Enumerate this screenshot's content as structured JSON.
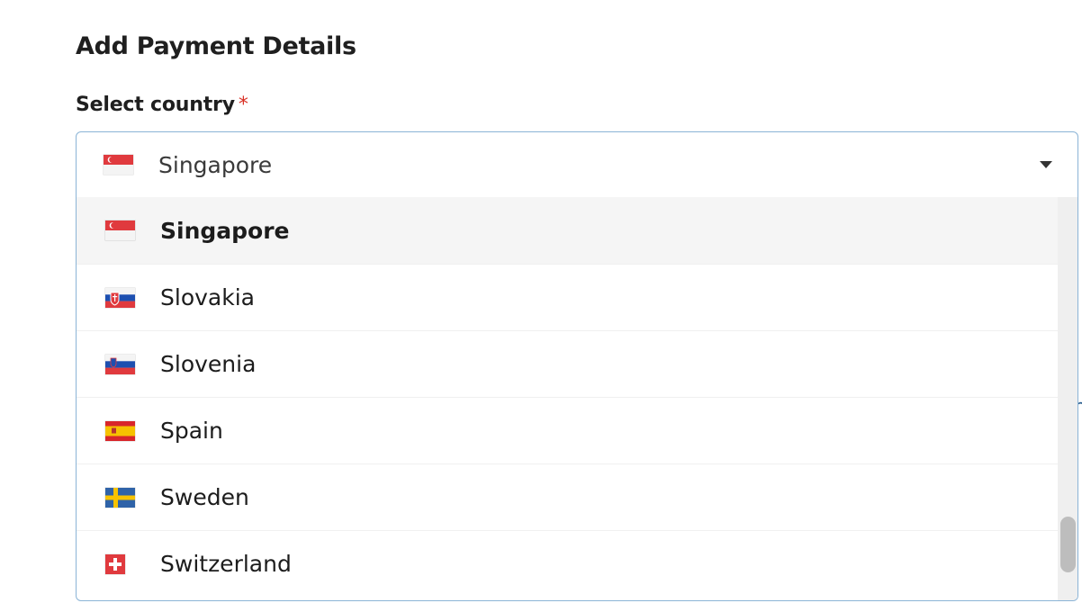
{
  "page": {
    "heading": "Add Payment Details",
    "country_label": "Select country",
    "required_mark": "*"
  },
  "select": {
    "selected_value": "Singapore",
    "selected_flag": "flag-singapore-icon",
    "options": [
      {
        "label": "Singapore",
        "flag": "flag-singapore-icon",
        "active": true
      },
      {
        "label": "Slovakia",
        "flag": "flag-slovakia-icon",
        "active": false
      },
      {
        "label": "Slovenia",
        "flag": "flag-slovenia-icon",
        "active": false
      },
      {
        "label": "Spain",
        "flag": "flag-spain-icon",
        "active": false
      },
      {
        "label": "Sweden",
        "flag": "flag-sweden-icon",
        "active": false
      },
      {
        "label": "Switzerland",
        "flag": "flag-switzerland-icon",
        "active": false
      }
    ]
  },
  "colors": {
    "focus_border": "#8bb4d6",
    "required": "#d93025",
    "active_option_bg": "#f5f5f5"
  }
}
